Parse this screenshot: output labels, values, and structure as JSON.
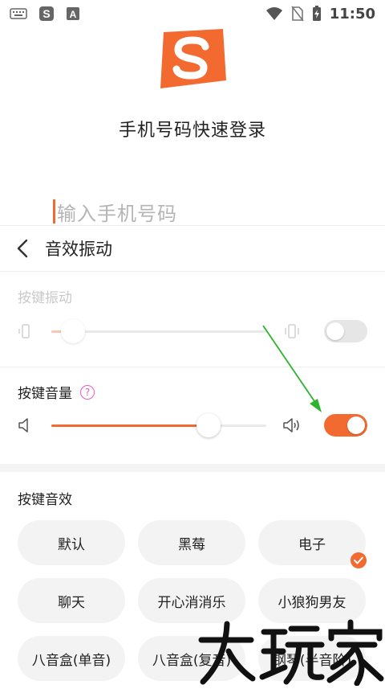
{
  "status_bar": {
    "time": "11:50",
    "left_icons": [
      "keyboard-icon",
      "sogou-icon",
      "font-icon"
    ],
    "right_icons": [
      "wifi-icon",
      "no-sim-icon",
      "battery-charging-icon"
    ]
  },
  "login": {
    "title": "手机号码快速登录",
    "phone_placeholder": "输入手机号码"
  },
  "sheet": {
    "title": "音效振动",
    "vibration": {
      "label": "按键振动",
      "level": 0.1,
      "enabled": false
    },
    "volume": {
      "label": "按键音量",
      "level": 0.73,
      "enabled": true
    },
    "sound_effects": {
      "label": "按键音效",
      "options": [
        {
          "label": "默认",
          "selected": false
        },
        {
          "label": "黑莓",
          "selected": false
        },
        {
          "label": "电子",
          "selected": true
        },
        {
          "label": "聊天",
          "selected": false
        },
        {
          "label": "开心消消乐",
          "selected": false
        },
        {
          "label": "小狼狗男友",
          "selected": false
        },
        {
          "label": "八音盒(单音)",
          "selected": false
        },
        {
          "label": "八音盒(复音)",
          "selected": false
        },
        {
          "label": "钢琴(半音阶)",
          "selected": false
        }
      ]
    }
  },
  "watermark": "大玩家",
  "colors": {
    "accent": "#f26a2f",
    "annotation_arrow": "#2fb32f",
    "help": "#e85cc6"
  }
}
